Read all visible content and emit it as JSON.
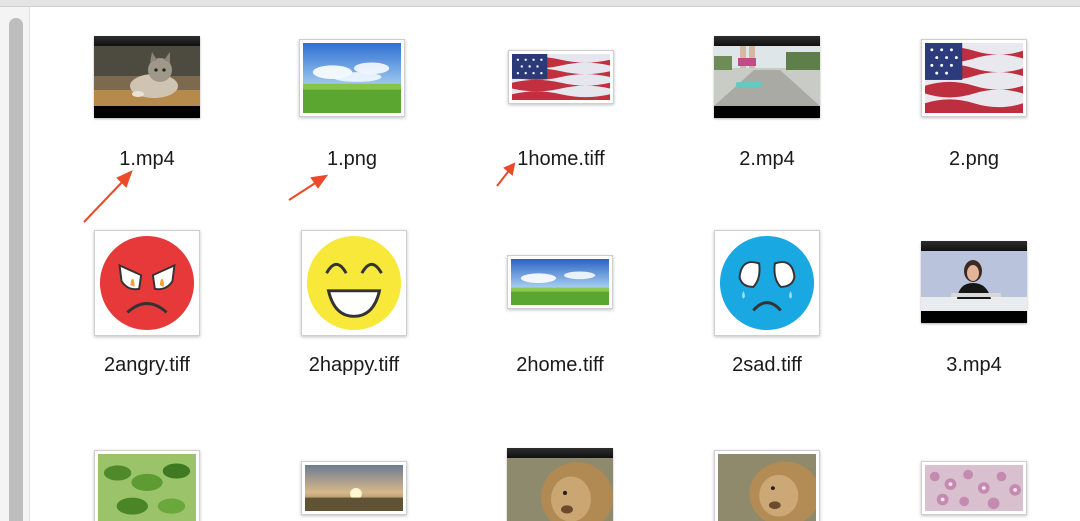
{
  "files": [
    {
      "name": "1.mp4",
      "thumb": "cat-video"
    },
    {
      "name": "1.png",
      "thumb": "sky-grass"
    },
    {
      "name": "1home.tiff",
      "thumb": "us-flag-small"
    },
    {
      "name": "2.mp4",
      "thumb": "skateboard-video"
    },
    {
      "name": "2.png",
      "thumb": "us-flag"
    },
    {
      "name": "2angry.tiff",
      "thumb": "angry-face"
    },
    {
      "name": "2happy.tiff",
      "thumb": "happy-face"
    },
    {
      "name": "2home.tiff",
      "thumb": "sky-grass-small"
    },
    {
      "name": "2sad.tiff",
      "thumb": "sad-face"
    },
    {
      "name": "3.mp4",
      "thumb": "woman-video"
    },
    {
      "name": "",
      "thumb": "leaves"
    },
    {
      "name": "",
      "thumb": "sunset-field"
    },
    {
      "name": "",
      "thumb": "lion-video"
    },
    {
      "name": "",
      "thumb": "lion"
    },
    {
      "name": "",
      "thumb": "flowers"
    }
  ],
  "annotation_color": "#ea4a2a"
}
